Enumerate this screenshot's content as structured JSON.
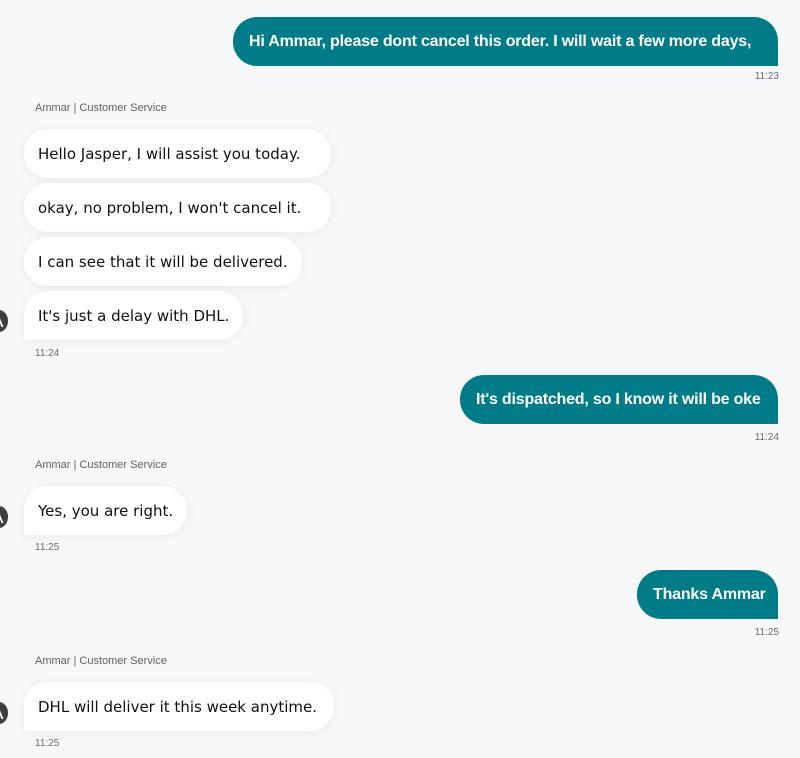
{
  "messages": [
    {
      "text": "Hi Ammar, please dont cancel this order. I will wait a few more days,",
      "time": "11:23"
    },
    {
      "sender": "Ammar | Customer Service"
    },
    {
      "text": "Hello Jasper, I will assist you today."
    },
    {
      "text": "okay, no problem, I won't cancel it."
    },
    {
      "text": "I can see that it will be delivered."
    },
    {
      "text": "It's just a delay with DHL.",
      "time": "11:24"
    },
    {
      "text": "It's dispatched, so I know it will be oke",
      "time": "11:24"
    },
    {
      "sender": "Ammar | Customer Service"
    },
    {
      "text": "Yes, you are right.",
      "time": "11:25"
    },
    {
      "text": "Thanks Ammar",
      "time": "11:25"
    },
    {
      "sender": "Ammar | Customer Service"
    },
    {
      "text": "DHL will deliver it this week anytime.",
      "time": "11:25"
    }
  ],
  "colors": {
    "outgoing_bubble": "#007b87",
    "incoming_bubble": "#ffffff",
    "background": "#f6f8f9"
  },
  "icons": {
    "agent_avatar": "agent-avatar-icon"
  }
}
